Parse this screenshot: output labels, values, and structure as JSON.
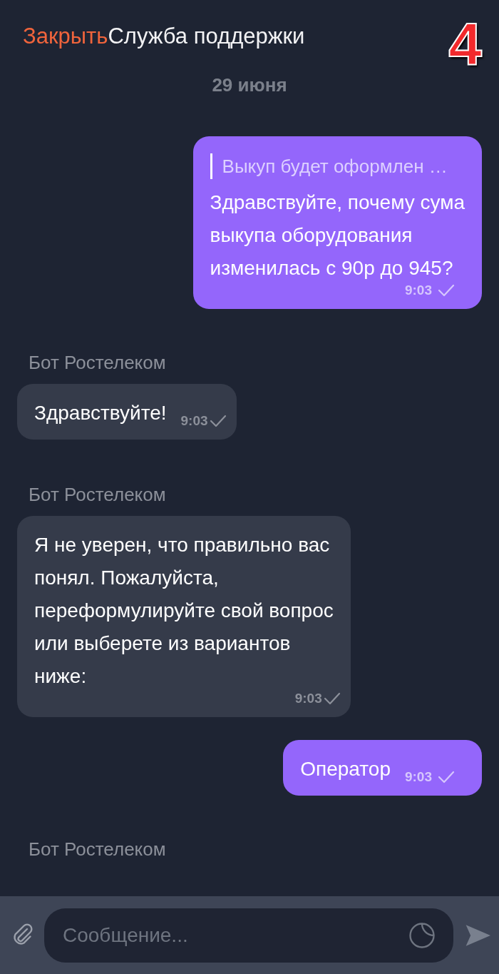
{
  "header": {
    "close_label": "Закрыть",
    "title": "Служба поддержки"
  },
  "overlay_number": "4",
  "date": "29 июня",
  "messages": [
    {
      "kind": "outgoing",
      "quote": "Выкуп будет оформлен …",
      "text": "Здравствуйте,  почему сума\nвыкупа оборудования\nизменилась с 90р до 945?",
      "time": "9:03",
      "read": true
    },
    {
      "kind": "incoming",
      "sender": "Бот Ростелеком",
      "text": "Здравствуйте!",
      "time": "9:03",
      "read": true
    },
    {
      "kind": "incoming",
      "sender": "Бот Ростелеком",
      "text": "Я не уверен, что правильно вас\nпонял. Пожалуйста,\nпереформулируйте свой вопрос\nили выберете из вариантов\nниже:",
      "time": "9:03",
      "read": true
    },
    {
      "kind": "outgoing",
      "text": "Оператор",
      "time": "9:03",
      "read": true
    },
    {
      "kind": "sender_only",
      "sender": "Бот Ростелеком"
    }
  ],
  "composer": {
    "placeholder": "Сообщение..."
  }
}
